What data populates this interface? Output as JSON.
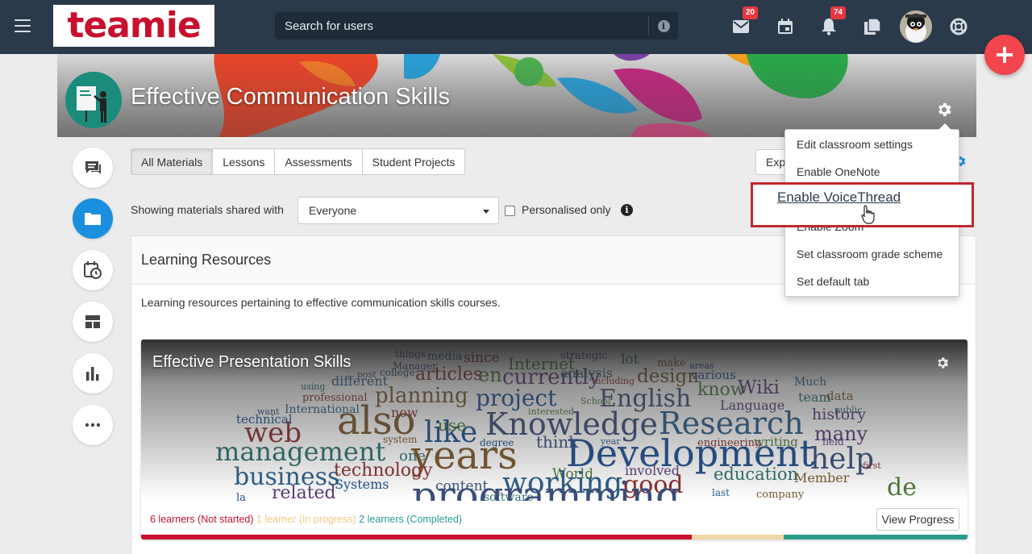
{
  "topbar": {
    "logo_text": "teamie",
    "search": {
      "placeholder": "Search for users"
    },
    "icons": {
      "menu": "hamburger-menu-icon",
      "mail": "mail-icon",
      "calendar": "calendar-icon",
      "notifications": "bell-icon",
      "files": "files-icon",
      "help": "lifebuoy-icon"
    },
    "mail_badge": "20",
    "notification_badge": "74",
    "fab_icon": "plus-icon"
  },
  "classroom": {
    "title": "Effective Communication Skills"
  },
  "rail": {
    "items": [
      "discussion-icon",
      "folder-icon",
      "calendar-clock-icon",
      "dashboard-icon",
      "bar-chart-icon",
      "more-icon"
    ]
  },
  "tabs": [
    "All Materials",
    "Lessons",
    "Assessments",
    "Student Projects"
  ],
  "export_button": "Exp",
  "filter": {
    "label": "Showing materials shared with",
    "selected": "Everyone",
    "personalised_label": "Personalised only"
  },
  "menu": {
    "items": [
      "Edit classroom settings",
      "Enable OneNote",
      "Enable VoiceThread",
      "Enable Zoom",
      "Set classroom grade scheme",
      "Set default tab"
    ],
    "highlighted": "Enable VoiceThread"
  },
  "panel": {
    "title": "Learning Resources",
    "description": "Learning resources pertaining to effective communication skills courses.",
    "card": {
      "title": "Effective Presentation Skills",
      "not_started": "6 learners (Not started)",
      "in_progress": "1 learner (In progress)",
      "completed": "2 learners (Completed)",
      "view_progress": "View Progress",
      "progress": {
        "not_started": 6,
        "in_progress": 1,
        "completed": 2
      }
    }
  },
  "word_cloud": [
    "things",
    "media",
    "since",
    "Internet",
    "strategic",
    "lot",
    "make",
    "areas",
    "Manager",
    "college",
    "articles",
    "en",
    "currently",
    "analysis",
    "design",
    "various",
    "post",
    "different",
    "including",
    "know",
    "Wiki",
    "using",
    "planning",
    "project",
    "English",
    "Much",
    "professional",
    "School",
    "Language",
    "team",
    "data",
    "technical",
    "want",
    "International",
    "now",
    "interested",
    "history",
    "public",
    "also",
    "like",
    "Knowledge",
    "Research",
    "web",
    "use",
    "many",
    "management",
    "system",
    "degree",
    "think",
    "year",
    "engineering",
    "writing",
    "field",
    "one",
    "years",
    "Development",
    "help",
    "business",
    "technology",
    "World",
    "involved",
    "education",
    "Member",
    "Systems",
    "content",
    "working",
    "good",
    "de",
    "related",
    "software",
    "company",
    "la",
    "programming",
    "last",
    "first"
  ],
  "colors": {
    "topbar": "#2b3a4a",
    "accent_blue": "#1a8fdd",
    "fab": "#f2464c",
    "highlight_border": "#c0282e",
    "not_started": "#c8102e",
    "in_progress": "#f0d6a8",
    "completed": "#2a9d8f"
  }
}
